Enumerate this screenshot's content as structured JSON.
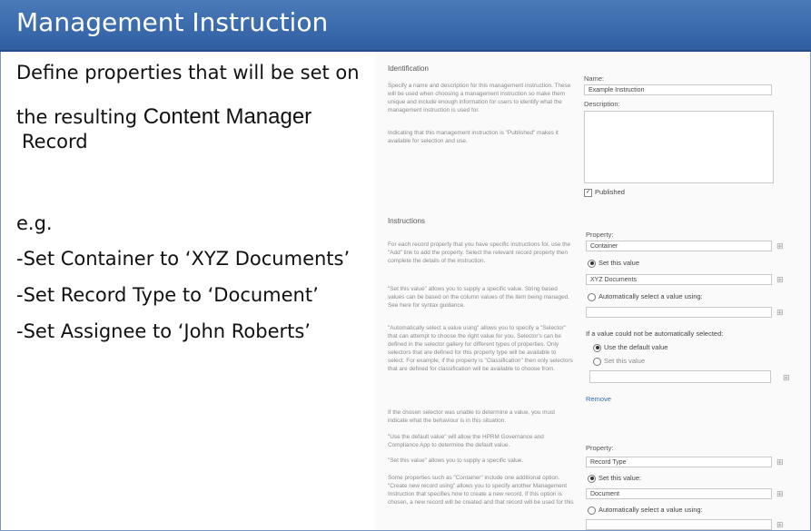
{
  "slide": {
    "title": "Management Instruction",
    "lines": [
      "Define properties that will be set on",
      "the resulting",
      "Content Manager",
      "Record",
      "e.g.",
      "-Set Container to ‘XYZ Documents’",
      "-Set Record Type to ‘Document’",
      "-Set Assignee to ‘John Roberts’"
    ]
  },
  "form": {
    "identification": {
      "heading": "Identification",
      "desc1": "Specify a name and description for this management instruction. These will be used when choosing a management instruction so make them unique and include enough information for users to identify what the management instruction is used for.",
      "desc2": "Indicating that this management instruction is \"Published\" makes it available for selection and use.",
      "name_label": "Name:",
      "name_value": "Example Instruction",
      "description_label": "Description:",
      "published_label": "Published"
    },
    "instructions": {
      "heading": "Instructions",
      "paragraphs": [
        "For each record property that you have specific instructions for, use the \"Add\" link to add the property. Select the relevant record property then complete the details of the instruction.",
        "\"Set this value\" allows you to supply a specific value. String based values can be based on the column values of the item being managed. See here for syntax guidance.",
        "\"Automatically select a value using\" allows you to specify a \"Selector\" that can attempt to choose the right value for you. Selector's can be defined in the selector gallery for different types of properties. Only selectors that are defined for this property type will be available to select. For example, if the property is \"Classification\" then only selectors that are defined for classification will be available to choose from.",
        "If the chosen selector was unable to determine a value, you must indicate what the behaviour is in this situation.",
        "\"Use the default value\" will allow the HPRM Governance and Compliance App to determine the default value.",
        "\"Set this value\" allows you to supply a specific value.",
        "Some properties such as \"Container\" include one additional option. \"Create new record using\" allows you to specify another Management Instruction that specifies how to create a new record. If this option is chosen, a new record will be created and that record will be used for this"
      ],
      "property1": {
        "label": "Property:",
        "value": "Container",
        "set_value_label": "Set this value",
        "set_value": "XYZ Documents",
        "auto_label": "Automatically select a value using:",
        "fallback_label": "If a value could not be automatically selected:",
        "use_default_label": "Use the default value",
        "set_this_label": "Set this value",
        "remove_label": "Remove"
      },
      "property2": {
        "label": "Property:",
        "value": "Record Type",
        "set_value_label": "Set this value:",
        "set_value": "Document",
        "auto_label": "Automatically select a value using:"
      }
    }
  }
}
